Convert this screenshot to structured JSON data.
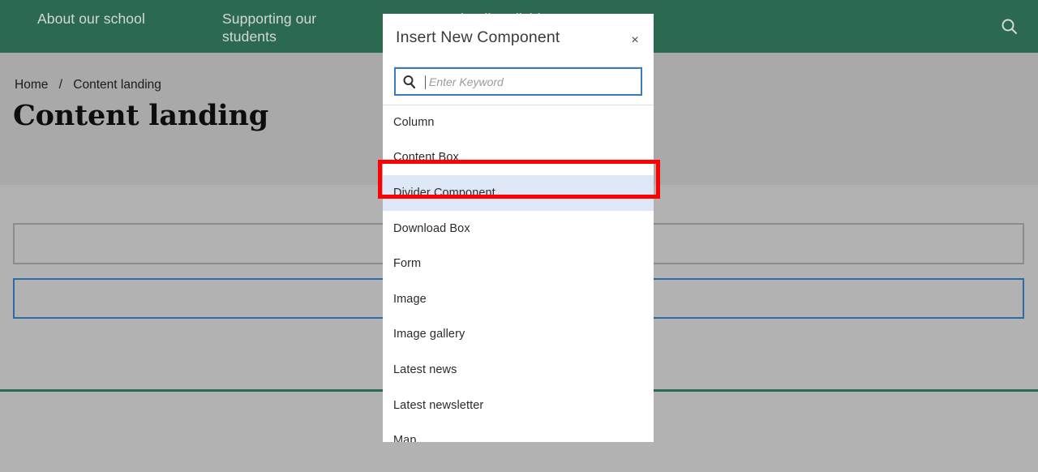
{
  "site": {
    "nav": [
      {
        "label": "About our school"
      },
      {
        "label": "Supporting our students"
      },
      {
        "label": "Content landing divider"
      }
    ],
    "search_icon": "search-icon",
    "breadcrumb": {
      "home": "Home",
      "separator": "/",
      "current": "Content landing"
    },
    "page_title": "Content landing",
    "accent_green": "#2b6a50",
    "overlay_gray": "#b2b2b2",
    "selected_region_border": "#2b6ba8"
  },
  "modal": {
    "title": "Insert New Component",
    "close_label": "×",
    "close_icon": "close-icon",
    "search": {
      "icon": "search-icon",
      "placeholder": "Enter Keyword",
      "value": ""
    },
    "items": [
      {
        "label": "Column",
        "highlighted": false
      },
      {
        "label": "Content Box",
        "highlighted": false
      },
      {
        "label": "Divider Component",
        "highlighted": true
      },
      {
        "label": "Download Box",
        "highlighted": false
      },
      {
        "label": "Form",
        "highlighted": false
      },
      {
        "label": "Image",
        "highlighted": false
      },
      {
        "label": "Image gallery",
        "highlighted": false
      },
      {
        "label": "Latest news",
        "highlighted": false
      },
      {
        "label": "Latest newsletter",
        "highlighted": false
      },
      {
        "label": "Map",
        "highlighted": false
      }
    ],
    "highlight_color": "#dde7f5",
    "focus_border": "#3a79c4"
  },
  "annotation": {
    "color": "#fe0000",
    "target": "Divider Component"
  }
}
